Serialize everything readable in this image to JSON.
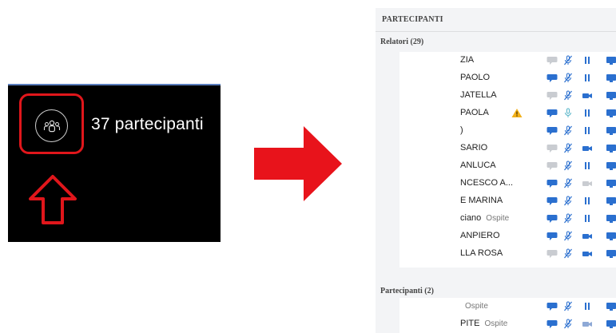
{
  "left_panel": {
    "count_text": "37 partecipanti",
    "people_icon": "people-group-icon",
    "highlight_color": "#e0161b"
  },
  "arrow_color": "#e8131b",
  "participants_panel": {
    "title": "PARTECIPANTI",
    "speakers_header": "Relatori (29)",
    "speakers": [
      {
        "name": "ZIA",
        "guest": "",
        "chat": "off",
        "mic": "muted",
        "cam": "paused",
        "warning": false
      },
      {
        "name": "PAOLO",
        "guest": "",
        "chat": "on",
        "mic": "muted",
        "cam": "paused",
        "warning": false
      },
      {
        "name": "JATELLA",
        "guest": "",
        "chat": "off",
        "mic": "muted",
        "cam": "video",
        "warning": false
      },
      {
        "name": "PAOLA",
        "guest": "",
        "chat": "on",
        "mic": "active",
        "cam": "paused",
        "warning": true
      },
      {
        "name": ")",
        "guest": "",
        "chat": "on",
        "mic": "muted",
        "cam": "paused",
        "warning": false
      },
      {
        "name": "SARIO",
        "guest": "",
        "chat": "off",
        "mic": "muted",
        "cam": "video",
        "warning": false
      },
      {
        "name": "ANLUCA",
        "guest": "",
        "chat": "off",
        "mic": "muted",
        "cam": "paused",
        "warning": false
      },
      {
        "name": "NCESCO A...",
        "guest": "",
        "chat": "on",
        "mic": "muted",
        "cam": "off",
        "warning": false
      },
      {
        "name": "E MARINA",
        "guest": "",
        "chat": "on",
        "mic": "muted",
        "cam": "paused",
        "warning": false
      },
      {
        "name": "ciano",
        "guest": "Ospite",
        "chat": "on",
        "mic": "muted",
        "cam": "paused",
        "warning": false
      },
      {
        "name": "ANPIERO",
        "guest": "",
        "chat": "on",
        "mic": "muted",
        "cam": "video",
        "warning": false
      },
      {
        "name": "LLA ROSA",
        "guest": "",
        "chat": "off",
        "mic": "muted",
        "cam": "video",
        "warning": false
      }
    ],
    "participants_header": "Partecipanti (2)",
    "participants": [
      {
        "name": "",
        "guest": "Ospite",
        "chat": "on",
        "mic": "muted",
        "cam": "paused",
        "warning": false
      },
      {
        "name": "PITE",
        "guest": "Ospite",
        "chat": "on",
        "mic": "muted",
        "cam": "video-dim",
        "warning": false
      }
    ],
    "icon_blue": "#2a6fcf"
  }
}
